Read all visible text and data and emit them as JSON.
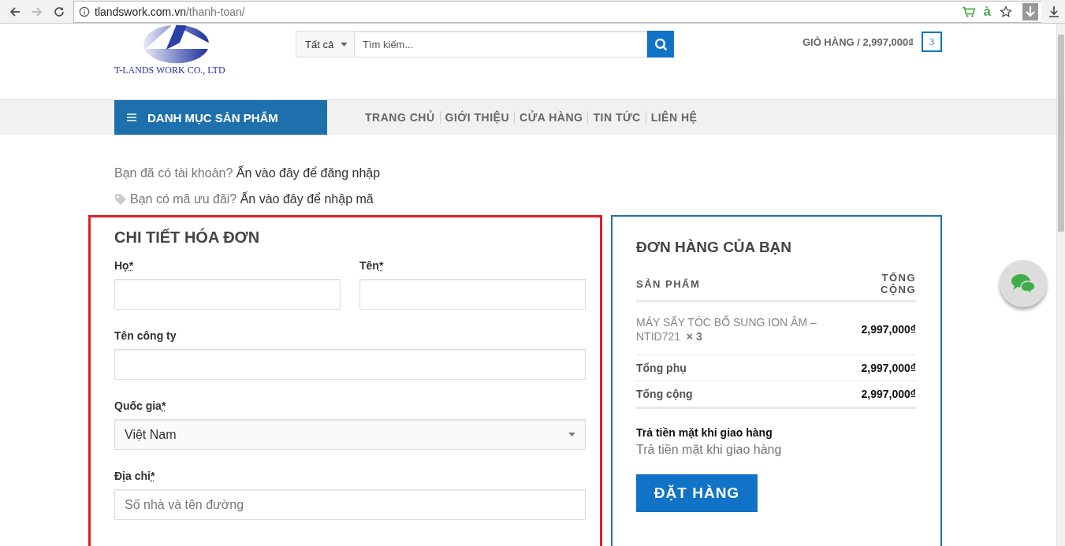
{
  "browser": {
    "url_host": "tlandswork.com.vn",
    "url_path": "/thanh-toan/",
    "extension_text": "à"
  },
  "header": {
    "logo_text": "T-LANDS WORK CO., LTD",
    "search": {
      "category": "Tất cả",
      "placeholder": "Tìm kiếm..."
    },
    "cart": {
      "label": "GIỎ HÀNG / 2,997,000₫",
      "count": "3"
    }
  },
  "nav": {
    "menu_label": "DANH MỤC SẢN PHẨM",
    "items": [
      "TRANG CHỦ",
      "GIỚI THIỆU",
      "CỬA HÀNG",
      "TIN TỨC",
      "LIÊN HỆ"
    ]
  },
  "notices": [
    {
      "kind": "plain",
      "text": "Bạn đã có tài khoản?",
      "link": "Ấn vào đây để đăng nhập"
    },
    {
      "kind": "coupon",
      "text": "Bạn có mã ưu đãi?",
      "link": "Ấn vào đây để nhập mã"
    }
  ],
  "billing": {
    "title": "CHI TIẾT HÓA ĐƠN",
    "rows": [
      [
        {
          "kind": "text",
          "label": "Họ",
          "required_mark": "*"
        },
        {
          "kind": "text",
          "label": "Tên",
          "required_mark": "*"
        }
      ],
      [
        {
          "kind": "text",
          "label": "Tên công ty"
        }
      ],
      [
        {
          "kind": "select",
          "label": "Quốc gia",
          "required_mark": "*",
          "value": "Việt Nam"
        }
      ],
      [
        {
          "kind": "text",
          "label": "Địa chỉ",
          "required_mark": "*",
          "placeholder": "Số nhà và tên đường"
        }
      ]
    ]
  },
  "order": {
    "title": "ĐƠN HÀNG CỦA BẠN",
    "columns": [
      "SẢN PHẨM",
      "TỔNG CỘNG"
    ],
    "items": [
      {
        "name": "MÁY SẤY TÓC BỔ SUNG ION ÂM – NTID721",
        "qty": "× 3",
        "total": "2,997,000₫"
      }
    ],
    "totals": [
      {
        "label": "Tổng phụ",
        "value": "2,997,000₫"
      },
      {
        "label": "Tổng cộng",
        "value": "2,997,000₫"
      }
    ],
    "payment": {
      "title": "Trả tiền mặt khi giao hàng",
      "description": "Trả tiền mặt khi giao hàng"
    },
    "button": "ĐẶT HÀNG"
  }
}
